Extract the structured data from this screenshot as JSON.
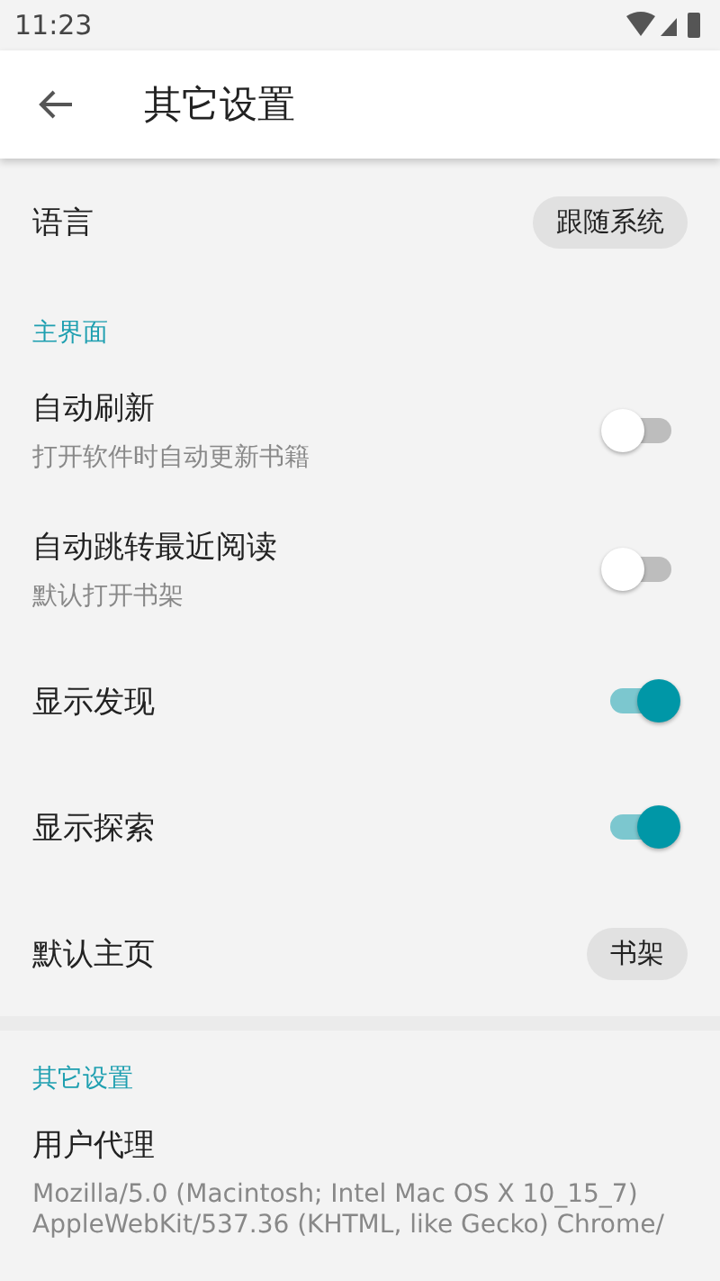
{
  "status_bar": {
    "time": "11:23"
  },
  "toolbar": {
    "title": "其它设置"
  },
  "sections": [
    {
      "items": [
        {
          "kind": "select",
          "title": "语言",
          "value": "跟随系统"
        }
      ]
    },
    {
      "header": "主界面",
      "items": [
        {
          "kind": "switch",
          "title": "自动刷新",
          "summary": "打开软件时自动更新书籍",
          "on": false
        },
        {
          "kind": "switch",
          "title": "自动跳转最近阅读",
          "summary": "默认打开书架",
          "on": false
        },
        {
          "kind": "switch",
          "title": "显示发现",
          "on": true
        },
        {
          "kind": "switch",
          "title": "显示探索",
          "on": true
        },
        {
          "kind": "select",
          "title": "默认主页",
          "value": "书架"
        }
      ]
    },
    {
      "header": "其它设置",
      "items": [
        {
          "kind": "text",
          "title": "用户代理",
          "summary": "Mozilla/5.0 (Macintosh; Intel Mac OS X 10_15_7) AppleWebKit/537.36 (KHTML, like Gecko) Chrome/"
        }
      ]
    }
  ]
}
